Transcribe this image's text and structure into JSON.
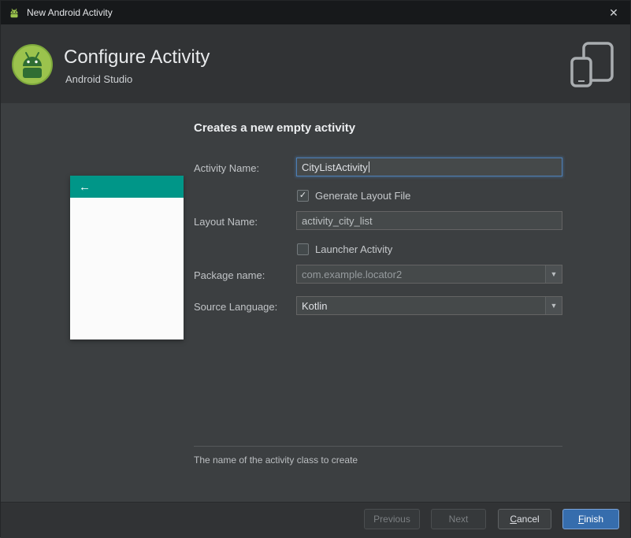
{
  "window": {
    "title": "New Android Activity",
    "close_icon": "✕"
  },
  "header": {
    "title": "Configure Activity",
    "subtitle": "Android Studio"
  },
  "main": {
    "heading": "Creates a new empty activity",
    "fields": {
      "activity_name": {
        "label": "Activity Name:",
        "value": "CityListActivity"
      },
      "generate_layout_file": {
        "label": "Generate Layout File",
        "checked": true
      },
      "layout_name": {
        "label": "Layout Name:",
        "value": "activity_city_list"
      },
      "launcher_activity": {
        "label": "Launcher Activity",
        "checked": false
      },
      "package_name": {
        "label": "Package name:",
        "value": "com.example.locator2"
      },
      "source_language": {
        "label": "Source Language:",
        "value": "Kotlin"
      }
    },
    "hint": "The name of the activity class to create"
  },
  "preview": {
    "back_arrow_icon": "←"
  },
  "footer": {
    "buttons": [
      {
        "label": "Previous",
        "enabled": false
      },
      {
        "label": "Next",
        "enabled": false
      },
      {
        "label": "Cancel",
        "enabled": true,
        "mnemonic": 0
      },
      {
        "label": "Finish",
        "enabled": true,
        "primary": true,
        "mnemonic": 0
      }
    ]
  },
  "icons": {
    "dropdown": "▼",
    "checkmark": "✓"
  },
  "colors": {
    "preview_teal": "#009688",
    "focus_blue": "#4e7fb5",
    "primary_button_blue": "#366dad",
    "brand_green": "#9bc34d"
  }
}
